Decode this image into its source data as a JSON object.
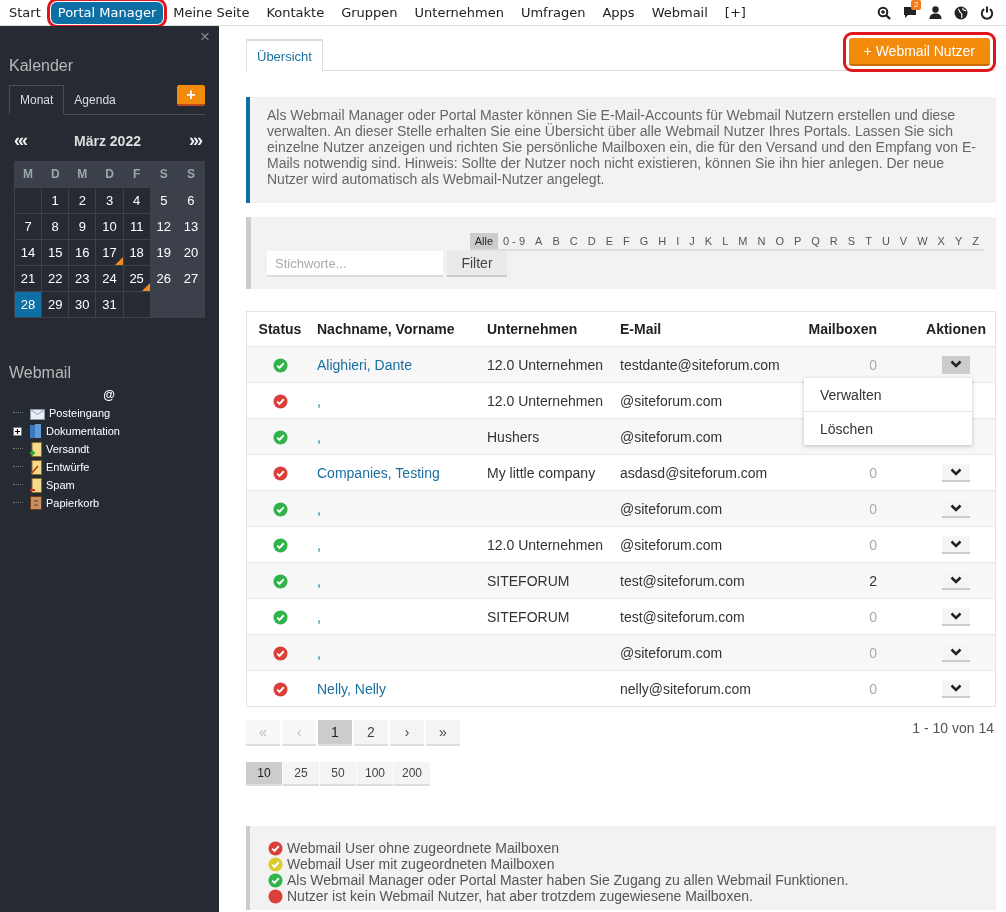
{
  "nav": {
    "items": [
      {
        "label": "Start",
        "selected": false,
        "highlighted": false
      },
      {
        "label": "Portal Manager",
        "selected": true,
        "highlighted": true
      },
      {
        "label": "Meine Seite",
        "selected": false,
        "highlighted": false
      },
      {
        "label": "Kontakte",
        "selected": false,
        "highlighted": false
      },
      {
        "label": "Gruppen",
        "selected": false,
        "highlighted": false
      },
      {
        "label": "Unternehmen",
        "selected": false,
        "highlighted": false
      },
      {
        "label": "Umfragen",
        "selected": false,
        "highlighted": false
      },
      {
        "label": "Apps",
        "selected": false,
        "highlighted": false
      },
      {
        "label": "Webmail",
        "selected": false,
        "highlighted": false
      },
      {
        "label": "[+]",
        "selected": false,
        "highlighted": false
      }
    ],
    "icons": [
      {
        "kind": "zoom"
      },
      {
        "kind": "chat",
        "badge": "2"
      },
      {
        "kind": "user"
      },
      {
        "kind": "globe"
      },
      {
        "kind": "power"
      }
    ]
  },
  "sidebar": {
    "close": "×",
    "calendar": {
      "title": "Kalender",
      "tabs": [
        {
          "label": "Monat",
          "selected": true
        },
        {
          "label": "Agenda",
          "selected": false
        }
      ],
      "add": "+",
      "prev": "«‹",
      "next": "›»",
      "month": "März 2022",
      "weekdays": [
        "M",
        "D",
        "M",
        "D",
        "F",
        "S",
        "S"
      ],
      "weeks": [
        [
          {
            "day": "1",
            "event": false,
            "selected": false
          },
          {
            "day": "2",
            "event": false,
            "selected": false
          },
          {
            "day": "3",
            "event": false,
            "selected": false
          },
          {
            "day": "4",
            "event": false,
            "selected": false
          },
          {
            "day": "5",
            "event": false,
            "selected": false
          },
          {
            "day": "6",
            "event": false,
            "selected": false
          }
        ],
        [
          {
            "day": "7",
            "event": false,
            "selected": false
          },
          {
            "day": "8",
            "event": false,
            "selected": false
          },
          {
            "day": "9",
            "event": false,
            "selected": false
          },
          {
            "day": "10",
            "event": false,
            "selected": false
          },
          {
            "day": "11",
            "event": false,
            "selected": false
          },
          {
            "day": "12",
            "event": false,
            "selected": false
          },
          {
            "day": "13",
            "event": false,
            "selected": false
          }
        ],
        [
          {
            "day": "14",
            "event": false,
            "selected": false
          },
          {
            "day": "15",
            "event": false,
            "selected": false
          },
          {
            "day": "16",
            "event": false,
            "selected": false
          },
          {
            "day": "17",
            "event": true,
            "selected": false
          },
          {
            "day": "18",
            "event": false,
            "selected": false
          },
          {
            "day": "19",
            "event": false,
            "selected": false
          },
          {
            "day": "20",
            "event": false,
            "selected": false
          }
        ],
        [
          {
            "day": "21",
            "event": false,
            "selected": false
          },
          {
            "day": "22",
            "event": false,
            "selected": false
          },
          {
            "day": "23",
            "event": false,
            "selected": false
          },
          {
            "day": "24",
            "event": false,
            "selected": false
          },
          {
            "day": "25",
            "event": true,
            "selected": false
          },
          {
            "day": "26",
            "event": false,
            "selected": false
          },
          {
            "day": "27",
            "event": false,
            "selected": false
          }
        ],
        [
          {
            "day": "28",
            "event": false,
            "selected": true
          },
          {
            "day": "29",
            "event": false,
            "selected": false
          },
          {
            "day": "30",
            "event": false,
            "selected": false
          },
          {
            "day": "31",
            "event": false,
            "selected": false
          }
        ]
      ]
    },
    "webmail": {
      "title": "Webmail",
      "root": "@",
      "folders": [
        {
          "label": "Posteingang",
          "kind": "inbox"
        },
        {
          "label": "Dokumentation",
          "kind": "docs",
          "expanded": false
        },
        {
          "label": "Versandt",
          "kind": "sent"
        },
        {
          "label": "Entwürfe",
          "kind": "drafts"
        },
        {
          "label": "Spam",
          "kind": "spam"
        },
        {
          "label": "Papierkorb",
          "kind": "trash"
        }
      ]
    }
  },
  "main": {
    "tabs": [
      {
        "label": "Übersicht",
        "selected": true
      }
    ],
    "add_button": {
      "label": "+ Webmail Nutzer",
      "highlighted": true
    },
    "info": "Als Webmail Manager oder Portal Master können Sie E-Mail-Accounts für Webmail Nutzern erstellen und diese verwalten. An dieser Stelle erhalten Sie eine Übersicht über alle Webmail Nutzer Ihres Portals. Lassen Sie sich einzelne Nutzer anzeigen und richten Sie persönliche Mailboxen ein, die für den Versand und den Empfang von E-Mails notwendig sind. Hinweis: Sollte der Nutzer noch nicht existieren, können Sie ihn hier anlegen. Der neue Nutzer wird automatisch als Webmail-Nutzer angelegt.",
    "letters": [
      {
        "label": "Alle",
        "selected": true
      },
      {
        "label": "0 - 9",
        "selected": false
      },
      {
        "label": "A",
        "selected": false
      },
      {
        "label": "B",
        "selected": false
      },
      {
        "label": "C",
        "selected": false
      },
      {
        "label": "D",
        "selected": false
      },
      {
        "label": "E",
        "selected": false
      },
      {
        "label": "F",
        "selected": false
      },
      {
        "label": "G",
        "selected": false
      },
      {
        "label": "H",
        "selected": false
      },
      {
        "label": "I",
        "selected": false
      },
      {
        "label": "J",
        "selected": false
      },
      {
        "label": "K",
        "selected": false
      },
      {
        "label": "L",
        "selected": false
      },
      {
        "label": "M",
        "selected": false
      },
      {
        "label": "N",
        "selected": false
      },
      {
        "label": "O",
        "selected": false
      },
      {
        "label": "P",
        "selected": false
      },
      {
        "label": "Q",
        "selected": false
      },
      {
        "label": "R",
        "selected": false
      },
      {
        "label": "S",
        "selected": false
      },
      {
        "label": "T",
        "selected": false
      },
      {
        "label": "U",
        "selected": false
      },
      {
        "label": "V",
        "selected": false
      },
      {
        "label": "W",
        "selected": false
      },
      {
        "label": "X",
        "selected": false
      },
      {
        "label": "Y",
        "selected": false
      },
      {
        "label": "Z",
        "selected": false
      }
    ],
    "search": {
      "placeholder": "Stichworte..."
    },
    "filter_button": "Filter",
    "table": {
      "columns": [
        "Status",
        "Nachname, Vorname",
        "Unternehmen",
        "E-Mail",
        "Mailboxen",
        "Aktionen"
      ],
      "rows": [
        {
          "kind": "ok",
          "name": "Alighieri, Dante",
          "company": "12.0 Unternehmen",
          "email": "testdante@siteforum.com",
          "mailboxes": "0",
          "has_mailboxes": false,
          "menu_open": true
        },
        {
          "kind": "error",
          "name": ",",
          "company": "12.0 Unternehmen",
          "email": "@siteforum.com"
        },
        {
          "kind": "ok",
          "name": ",",
          "company": "Hushers",
          "email": "@siteforum.com"
        },
        {
          "kind": "error",
          "name": "Companies, Testing",
          "company": "My little company",
          "email": "asdasd@siteforum.com",
          "mailboxes": "0",
          "has_mailboxes": false,
          "menu_open": false
        },
        {
          "kind": "ok",
          "name": ",",
          "email": "@siteforum.com",
          "mailboxes": "0",
          "has_mailboxes": false,
          "menu_open": false
        },
        {
          "kind": "ok",
          "name": ",",
          "company": "12.0 Unternehmen",
          "email": "@siteforum.com",
          "mailboxes": "0",
          "has_mailboxes": false,
          "menu_open": false
        },
        {
          "kind": "ok",
          "name": ",",
          "company": "SITEFORUM",
          "email": "test@siteforum.com",
          "mailboxes": "2",
          "has_mailboxes": true,
          "menu_open": false
        },
        {
          "kind": "ok",
          "name": ",",
          "company": "SITEFORUM",
          "email": "test@siteforum.com",
          "mailboxes": "0",
          "has_mailboxes": false,
          "menu_open": false
        },
        {
          "kind": "error",
          "name": ",",
          "email": "@siteforum.com",
          "mailboxes": "0",
          "has_mailboxes": false,
          "menu_open": false
        },
        {
          "kind": "error",
          "name": "Nelly, Nelly",
          "email": "nelly@siteforum.com",
          "mailboxes": "0",
          "has_mailboxes": false,
          "menu_open": false
        }
      ],
      "row_menu": [
        "Verwalten",
        "Löschen"
      ]
    },
    "pagination": [
      {
        "label": "«",
        "selected": false,
        "disabled": true
      },
      {
        "label": "‹",
        "selected": false,
        "disabled": true
      },
      {
        "label": "1",
        "selected": true,
        "disabled": false
      },
      {
        "label": "2",
        "selected": false,
        "disabled": false
      },
      {
        "label": "›",
        "selected": false,
        "disabled": false
      },
      {
        "label": "»",
        "selected": false,
        "disabled": false
      }
    ],
    "range": "1 - 10 von 14",
    "page_sizes": [
      {
        "label": "10",
        "selected": true
      },
      {
        "label": "25",
        "selected": false
      },
      {
        "label": "50",
        "selected": false
      },
      {
        "label": "100",
        "selected": false
      },
      {
        "label": "200",
        "selected": false
      }
    ],
    "legend": [
      {
        "kind": "error",
        "text": "Webmail User ohne zugeordnete Mailboxen"
      },
      {
        "kind": "partial",
        "text": "Webmail User mit zugeordneten Mailboxen"
      },
      {
        "kind": "ok",
        "text": "Als Webmail Manager oder Portal Master haben Sie Zugang zu allen Webmail Funktionen."
      },
      {
        "kind": "blocked",
        "text": "Nutzer ist kein Webmail Nutzer, hat aber trotzdem zugewiesene Mailboxen."
      }
    ]
  }
}
